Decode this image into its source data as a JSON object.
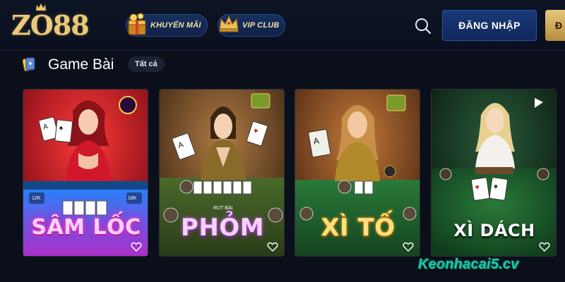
{
  "header": {
    "logo": "ZO88",
    "nav": [
      {
        "label": "KHUYẾN MÃI",
        "icon": "gift-treasure-icon"
      },
      {
        "label": "VIP CLUB",
        "icon": "vip-crown-icon"
      }
    ],
    "search_icon": "search-icon",
    "login_label": "ĐĂNG NHẬP",
    "register_label": "Đ"
  },
  "section": {
    "icon": "cards-deck-icon",
    "title": "Game Bài",
    "see_all": "Tất cả"
  },
  "games": [
    {
      "title": "SÂM LỐC",
      "theme": "#c8182e"
    },
    {
      "title": "PHỎM",
      "theme": "#6b4a25"
    },
    {
      "title": "XÌ TỐ",
      "theme": "#8a4a1a"
    },
    {
      "title": "XÌ DÁCH",
      "theme": "#1a4a2a"
    }
  ],
  "card_labels": [
    "12K",
    "18K",
    "RÚT BÀI"
  ],
  "watermark": "Keonhacai5.cv",
  "colors": {
    "gold": "#e9c97a",
    "navy": "#10275a",
    "bg": "#0b0f1a"
  }
}
